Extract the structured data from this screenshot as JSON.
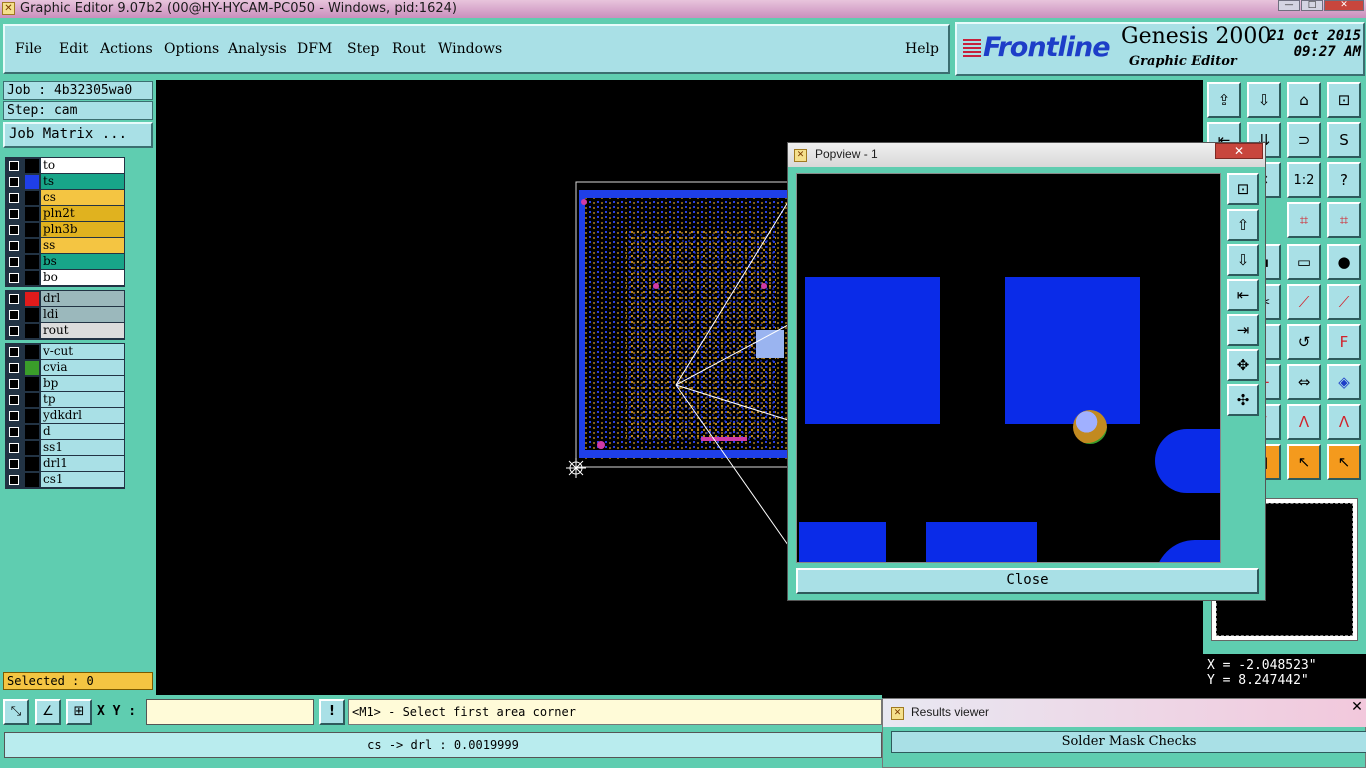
{
  "window": {
    "title": "Graphic Editor 9.07b2 (00@HY-HYCAM-PC050 - Windows, pid:1624)"
  },
  "menu": {
    "items": [
      "File",
      "Edit",
      "Actions",
      "Options",
      "Analysis",
      "DFM",
      "Step",
      "Rout",
      "Windows"
    ],
    "help": "Help"
  },
  "brand": {
    "logo": "Frontline",
    "product": "Genesis 2000",
    "subtitle": "Graphic Editor",
    "date": "21 Oct 2015",
    "time": "09:27 AM"
  },
  "job": {
    "job_label": "Job : 4b32305wa0",
    "step_label": "Step: cam",
    "matrix_button": "Job Matrix ..."
  },
  "layers": {
    "group1": [
      {
        "name": "to",
        "color": "#ffffff",
        "swatch": "#000000"
      },
      {
        "name": "ts",
        "color": "#18a589",
        "swatch": "#1f3fe8"
      },
      {
        "name": "cs",
        "color": "#f4c542",
        "swatch": "#000000"
      },
      {
        "name": "pln2t",
        "color": "#e0b21f",
        "swatch": "#000000"
      },
      {
        "name": "pln3b",
        "color": "#e0b21f",
        "swatch": "#000000"
      },
      {
        "name": "ss",
        "color": "#f4c542",
        "swatch": "#000000"
      },
      {
        "name": "bs",
        "color": "#18a589",
        "swatch": "#000000"
      },
      {
        "name": "bo",
        "color": "#ffffff",
        "swatch": "#000000"
      }
    ],
    "group2": [
      {
        "name": "drl",
        "color": "#9bb8bc",
        "swatch": "#e11b1b"
      },
      {
        "name": "ldi",
        "color": "#9bb8bc",
        "swatch": "#000000"
      },
      {
        "name": "rout",
        "color": "#dcdcdc",
        "swatch": "#000000"
      }
    ],
    "group3": [
      {
        "name": "v-cut",
        "color": "#a9e0e6",
        "swatch": "#000000"
      },
      {
        "name": "cvia",
        "color": "#a9e0e6",
        "swatch": "#3a9d2a"
      },
      {
        "name": "bp",
        "color": "#a9e0e6",
        "swatch": "#000000"
      },
      {
        "name": "tp",
        "color": "#a9e0e6",
        "swatch": "#000000"
      },
      {
        "name": "ydkdrl",
        "color": "#a9e0e6",
        "swatch": "#000000"
      },
      {
        "name": "d",
        "color": "#a9e0e6",
        "swatch": "#000000"
      },
      {
        "name": "ss1",
        "color": "#a9e0e6",
        "swatch": "#000000"
      },
      {
        "name": "drl1",
        "color": "#a9e0e6",
        "swatch": "#000000"
      },
      {
        "name": "cs1",
        "color": "#a9e0e6",
        "swatch": "#000000"
      }
    ]
  },
  "selected": "Selected : 0",
  "popview": {
    "title": "Popview - 1",
    "close_label": "Close"
  },
  "coords": {
    "x": "X = -2.048523\"",
    "y": "Y = 8.247442\""
  },
  "command": {
    "xy_label": "X Y :",
    "xy_value": "",
    "prompt": "<M1> - Select first area corner"
  },
  "status": {
    "text": "cs -> drl : 0.0019999"
  },
  "results": {
    "title": "Results viewer",
    "section": "Solder Mask Checks"
  },
  "colors": {
    "panel": "#5fcdb0",
    "button": "#a9e0e6",
    "pad_blue": "#0a2be8"
  }
}
